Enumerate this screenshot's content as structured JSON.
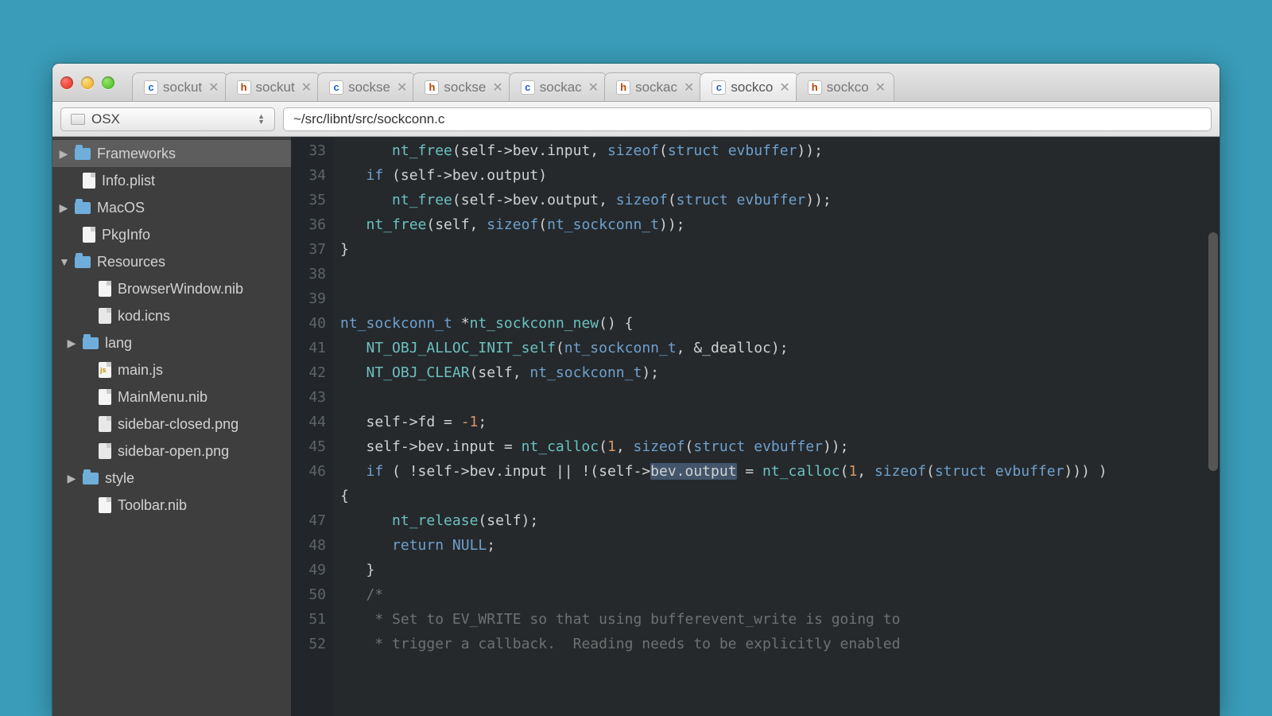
{
  "scheme": "OSX",
  "path": "~/src/libnt/src/sockconn.c",
  "tabs": [
    {
      "type": "c",
      "label": "sockut",
      "active": false
    },
    {
      "type": "h",
      "label": "sockut",
      "active": false
    },
    {
      "type": "c",
      "label": "sockse",
      "active": false
    },
    {
      "type": "h",
      "label": "sockse",
      "active": false
    },
    {
      "type": "c",
      "label": "sockac",
      "active": false
    },
    {
      "type": "h",
      "label": "sockac",
      "active": false
    },
    {
      "type": "c",
      "label": "sockco",
      "active": true
    },
    {
      "type": "h",
      "label": "sockco",
      "active": false
    }
  ],
  "sidebar": [
    {
      "kind": "folder",
      "label": "Frameworks",
      "arrow": "right",
      "indent": 0,
      "selected": true
    },
    {
      "kind": "file",
      "label": "Info.plist",
      "arrow": "",
      "indent": 1
    },
    {
      "kind": "folder",
      "label": "MacOS",
      "arrow": "right",
      "indent": 0
    },
    {
      "kind": "file",
      "label": "PkgInfo",
      "arrow": "",
      "indent": 1
    },
    {
      "kind": "folder",
      "label": "Resources",
      "arrow": "down",
      "indent": 0
    },
    {
      "kind": "file",
      "label": "BrowserWindow.nib",
      "arrow": "",
      "indent": 2
    },
    {
      "kind": "file-img",
      "label": "kod.icns",
      "arrow": "",
      "indent": 2
    },
    {
      "kind": "folder",
      "label": "lang",
      "arrow": "right",
      "indent": 1
    },
    {
      "kind": "file-js",
      "label": "main.js",
      "arrow": "",
      "indent": 2
    },
    {
      "kind": "file",
      "label": "MainMenu.nib",
      "arrow": "",
      "indent": 2
    },
    {
      "kind": "file-img",
      "label": "sidebar-closed.png",
      "arrow": "",
      "indent": 2
    },
    {
      "kind": "file-img",
      "label": "sidebar-open.png",
      "arrow": "",
      "indent": 2
    },
    {
      "kind": "folder",
      "label": "style",
      "arrow": "right",
      "indent": 1
    },
    {
      "kind": "file",
      "label": "Toolbar.nib",
      "arrow": "",
      "indent": 2
    }
  ],
  "lines": [
    {
      "n": 33,
      "html": "      <span class='fn'>nt_free</span>(self-&gt;bev.input, <span class='kw'>sizeof</span>(<span class='kw'>struct</span> <span class='type'>evbuffer</span>));"
    },
    {
      "n": 34,
      "html": "   <span class='kw'>if</span> (self-&gt;bev.output)"
    },
    {
      "n": 35,
      "html": "      <span class='fn'>nt_free</span>(self-&gt;bev.output, <span class='kw'>sizeof</span>(<span class='kw'>struct</span> <span class='type'>evbuffer</span>));"
    },
    {
      "n": 36,
      "html": "   <span class='fn'>nt_free</span>(self, <span class='kw'>sizeof</span>(<span class='type'>nt_sockconn_t</span>));"
    },
    {
      "n": 37,
      "html": "}"
    },
    {
      "n": 38,
      "html": ""
    },
    {
      "n": 39,
      "html": ""
    },
    {
      "n": 40,
      "html": "<span class='type'>nt_sockconn_t</span> *<span class='fn'>nt_sockconn_new</span>() {"
    },
    {
      "n": 41,
      "html": "   <span class='fn'>NT_OBJ_ALLOC_INIT_self</span>(<span class='type'>nt_sockconn_t</span>, &amp;_dealloc);"
    },
    {
      "n": 42,
      "html": "   <span class='fn'>NT_OBJ_CLEAR</span>(self, <span class='type'>nt_sockconn_t</span>);"
    },
    {
      "n": 43,
      "html": ""
    },
    {
      "n": 44,
      "html": "   self-&gt;fd = <span class='num'>-1</span>;"
    },
    {
      "n": 45,
      "html": "   self-&gt;bev.input = <span class='fn'>nt_calloc</span>(<span class='num'>1</span>, <span class='kw'>sizeof</span>(<span class='kw'>struct</span> <span class='type'>evbuffer</span>));"
    },
    {
      "n": 46,
      "html": "   <span class='kw'>if</span> ( !self-&gt;bev.input || !(self-&gt;<span class='hl'>bev.output</span> = <span class='fn'>nt_calloc</span>(<span class='num'>1</span>, <span class='kw'>sizeof</span>(<span class='kw'>struct</span> <span class='type'>evbuffer</span>))) )"
    },
    {
      "n": "",
      "html": "{"
    },
    {
      "n": 47,
      "html": "      <span class='fn'>nt_release</span>(self);"
    },
    {
      "n": 48,
      "html": "      <span class='kw'>return</span> <span class='kw'>NULL</span>;"
    },
    {
      "n": 49,
      "html": "   }"
    },
    {
      "n": 50,
      "html": "   <span class='cmt'>/*</span>"
    },
    {
      "n": 51,
      "html": "   <span class='cmt'> * Set to EV_WRITE so that using bufferevent_write is going to</span>"
    },
    {
      "n": 52,
      "html": "   <span class='cmt'> * trigger a callback.  Reading needs to be explicitly enabled</span>"
    }
  ]
}
